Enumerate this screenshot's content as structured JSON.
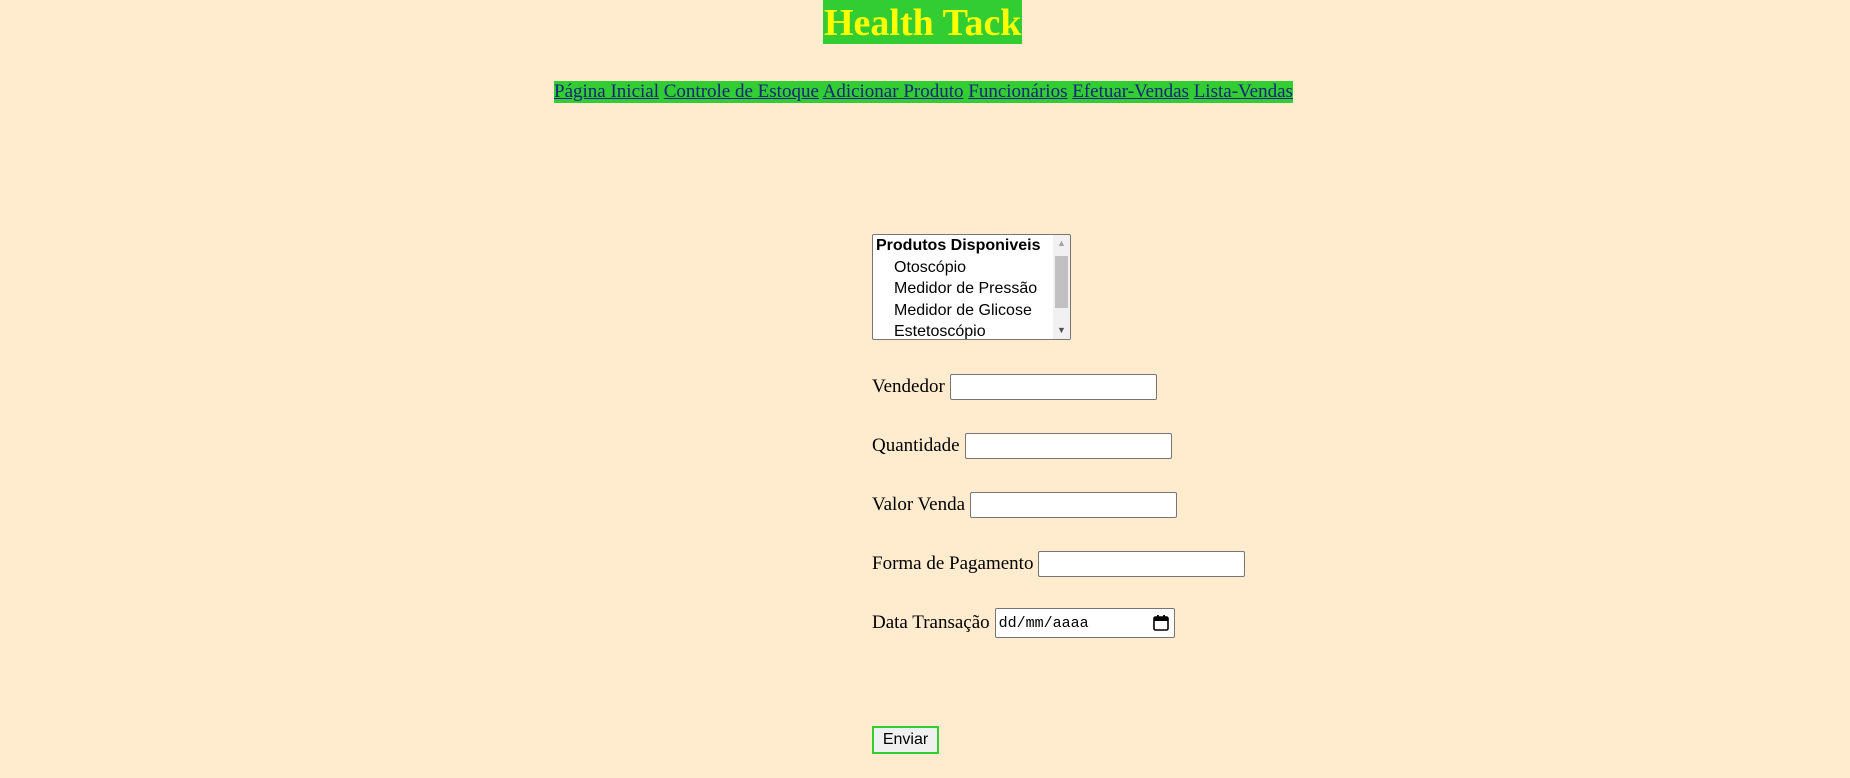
{
  "header": {
    "title": "Health Tack"
  },
  "nav": {
    "items": [
      {
        "label": "Página Inicial"
      },
      {
        "label": "Controle de Estoque"
      },
      {
        "label": "Adicionar Produto"
      },
      {
        "label": "Funcionários"
      },
      {
        "label": "Efetuar-Vendas"
      },
      {
        "label": "Lista-Vendas"
      }
    ]
  },
  "colors": {
    "background": "#ffebcd",
    "accent": "#32cd32",
    "title_text": "#ffff00",
    "link_text": "#1a237e"
  },
  "form": {
    "products": {
      "group_label": "Produtos Disponiveis",
      "options": [
        "Otoscópio",
        "Medidor de Pressão",
        "Medidor de Glicose",
        "Estetoscópio"
      ]
    },
    "fields": [
      {
        "label": "Vendedor",
        "value": ""
      },
      {
        "label": "Quantidade",
        "value": ""
      },
      {
        "label": "Valor Venda",
        "value": ""
      },
      {
        "label": "Forma de Pagamento",
        "value": ""
      }
    ],
    "date": {
      "label": "Data Transação",
      "placeholder": "dd/mm/aaaa",
      "icon": "calendar-icon"
    },
    "submit_label": "Enviar"
  }
}
